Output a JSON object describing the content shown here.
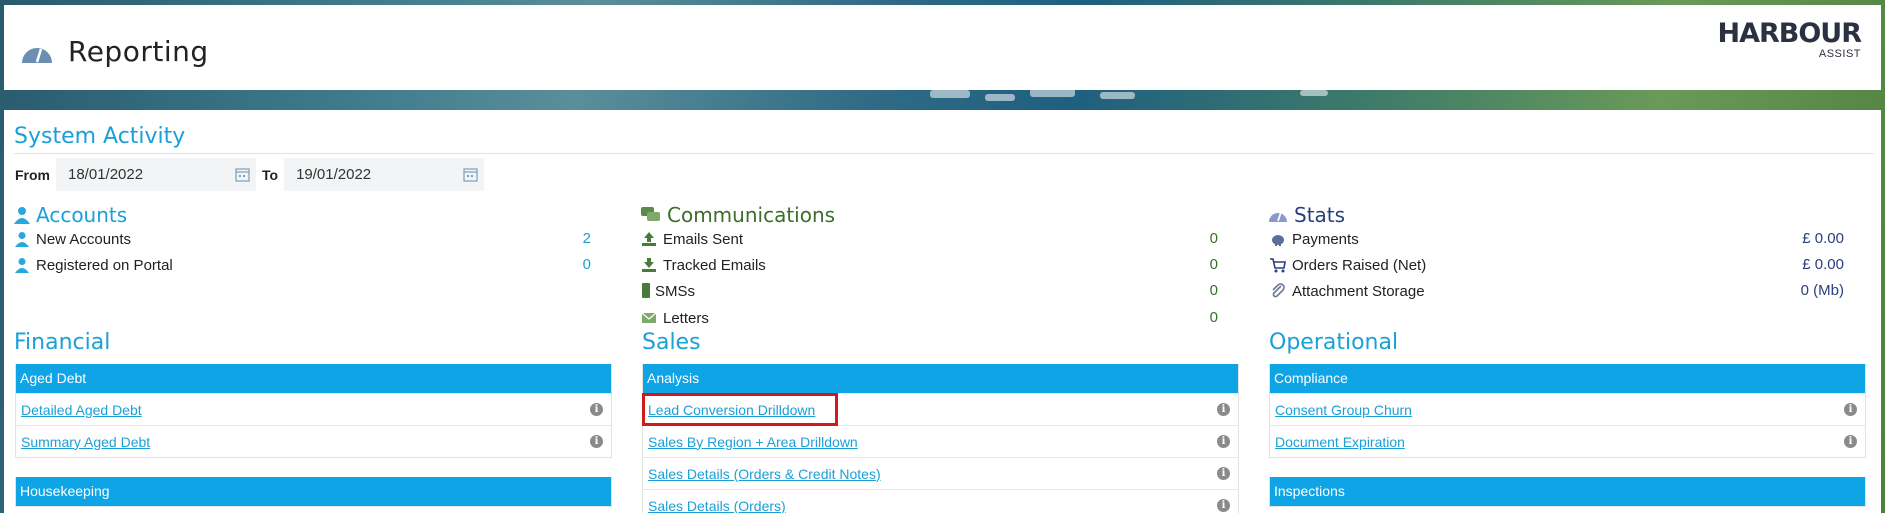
{
  "header": {
    "title": "Reporting",
    "logo_main": "HARBOUR",
    "logo_sub": "ASSIST"
  },
  "system_activity": {
    "title": "System Activity",
    "from_label": "From",
    "from_value": "18/01/2022",
    "to_label": "To",
    "to_value": "19/01/2022"
  },
  "accounts": {
    "title": "Accounts",
    "rows": [
      {
        "label": "New Accounts",
        "value": "2"
      },
      {
        "label": "Registered on Portal",
        "value": "0"
      }
    ]
  },
  "communications": {
    "title": "Communications",
    "rows": [
      {
        "label": "Emails Sent",
        "value": "0"
      },
      {
        "label": "Tracked Emails",
        "value": "0"
      },
      {
        "label": "SMSs",
        "value": "0"
      },
      {
        "label": "Letters",
        "value": "0"
      }
    ]
  },
  "stats": {
    "title": "Stats",
    "rows": [
      {
        "label": "Payments",
        "value": "£ 0.00"
      },
      {
        "label": "Orders Raised (Net)",
        "value": "£ 0.00"
      },
      {
        "label": "Attachment Storage",
        "value": "0 (Mb)"
      }
    ]
  },
  "financial": {
    "title": "Financial",
    "aged_debt": {
      "header": "Aged Debt",
      "items": [
        "Detailed Aged Debt",
        "Summary Aged Debt"
      ]
    },
    "housekeeping": {
      "header": "Housekeeping"
    }
  },
  "sales": {
    "title": "Sales",
    "analysis": {
      "header": "Analysis",
      "items": [
        "Lead Conversion Drilldown",
        "Sales By Region + Area Drilldown",
        "Sales Details (Orders & Credit Notes)",
        "Sales Details (Orders)"
      ]
    }
  },
  "operational": {
    "title": "Operational",
    "compliance": {
      "header": "Compliance",
      "items": [
        "Consent Group Churn",
        "Document Expiration"
      ]
    },
    "inspections": {
      "header": "Inspections"
    }
  },
  "colors": {
    "accent": "#0fa4e6",
    "comm_green": "#3a6e2a",
    "stats_navy": "#2a3f7a",
    "highlight": "#d11b1b"
  }
}
